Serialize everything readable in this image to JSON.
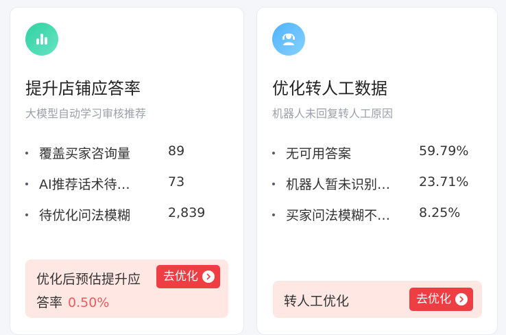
{
  "cards": [
    {
      "icon": "bar-chart-icon",
      "title": "提升店铺应答率",
      "subtitle": "大模型自动学习审核推荐",
      "metrics": [
        {
          "label": "覆盖买家咨询量",
          "value": "89"
        },
        {
          "label": "AI推荐话术待…",
          "value": "73"
        },
        {
          "label": "待优化问法模糊",
          "value": "2,839"
        }
      ],
      "tip_text_line1": "优化后预估提升应",
      "tip_text_line2": "答率",
      "tip_rate": "0.50%",
      "button_label": "去优化"
    },
    {
      "icon": "service-agent-icon",
      "title": "优化转人工数据",
      "subtitle": "机器人未回复转人工原因",
      "metrics": [
        {
          "label": "无可用答案",
          "value": "59.79%"
        },
        {
          "label": "机器人暂未识别…",
          "value": "23.71%"
        },
        {
          "label": "买家问法模糊不…",
          "value": "8.25%"
        }
      ],
      "tip_text": "转人工优化",
      "button_label": "去优化"
    }
  ],
  "colors": {
    "accent_red": "#ee3e43",
    "tip_background": "#ffe8e4",
    "rate_text": "#f25a5a",
    "icon_green": "#2fd1a1",
    "icon_blue": "#4eb3ff"
  }
}
